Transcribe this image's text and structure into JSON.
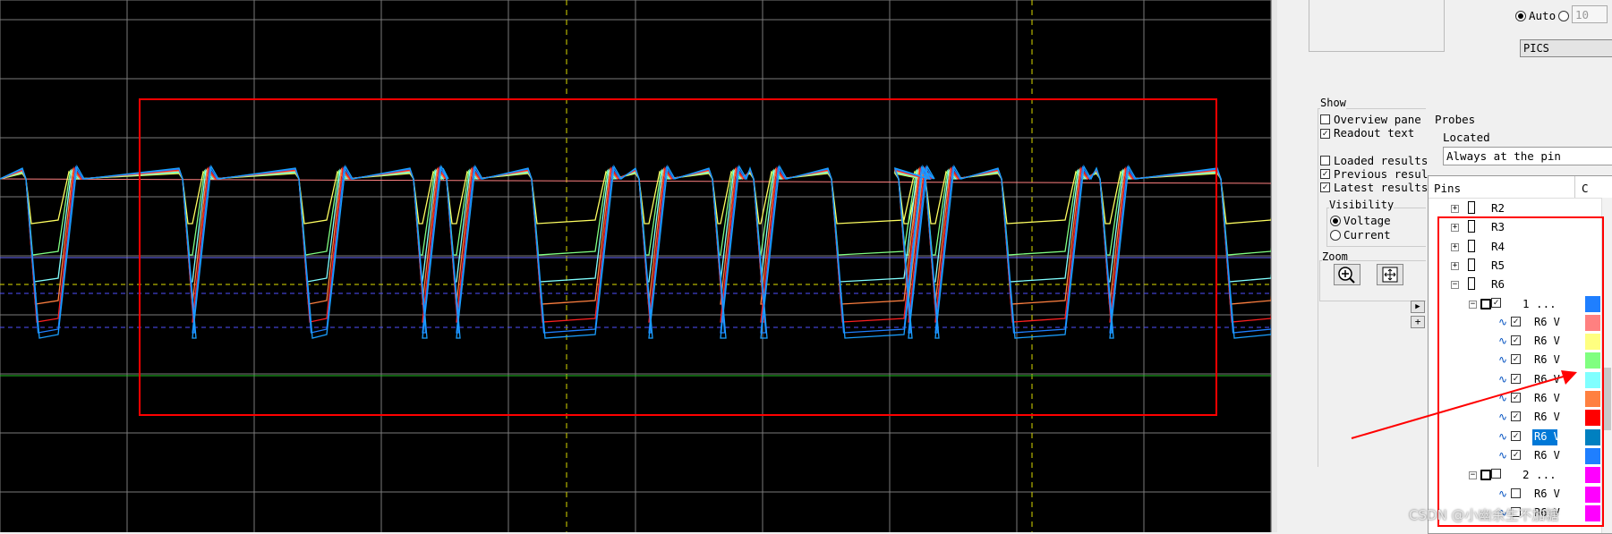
{
  "scope": {
    "colors": {
      "background": "#000000",
      "grid": "#7a7a7a",
      "marker_v": "#d8d800",
      "highlight": "#ff0000"
    }
  },
  "panel": {
    "auto_label": "Auto",
    "step_value": "10",
    "pics_button": "PICS Options...",
    "show": {
      "title": "Show",
      "overview": {
        "label": "Overview pane",
        "checked": false
      },
      "readout": {
        "label": "Readout text",
        "checked": true
      },
      "loaded": {
        "label": "Loaded results",
        "checked": false
      },
      "previous": {
        "label": "Previous resul",
        "checked": true
      },
      "latest": {
        "label": "Latest results",
        "checked": true
      }
    },
    "probes": {
      "title": "Probes",
      "located_label": "Located",
      "located_value": "Always at the pin"
    },
    "visibility": {
      "title": "Visibility",
      "voltage": "Voltage",
      "current": "Current",
      "selected": "voltage"
    },
    "zoom": {
      "title": "Zoom",
      "zoom_in_icon": "zoom-in-icon",
      "zoom_fit_icon": "zoom-fit-icon"
    },
    "pins": {
      "header": "Pins",
      "header_c": "C",
      "nets": [
        "R2",
        "R3",
        "R4",
        "R5",
        "R6"
      ],
      "group1_label": "1 ...",
      "group2_label": "2 ...",
      "probe_label": "R6 V",
      "probe_colors": [
        "#ff8080",
        "#ffff80",
        "#80ff80",
        "#80ffff",
        "#ff8040",
        "#ff0000",
        "#0080c0",
        "#1f7fff"
      ],
      "group1_color": "#1f7fff",
      "group2_colors": [
        "#ff00ff",
        "#ff00ff",
        "#ff00ff"
      ]
    }
  },
  "watermark": "CSDN @小幽余生不加糖"
}
